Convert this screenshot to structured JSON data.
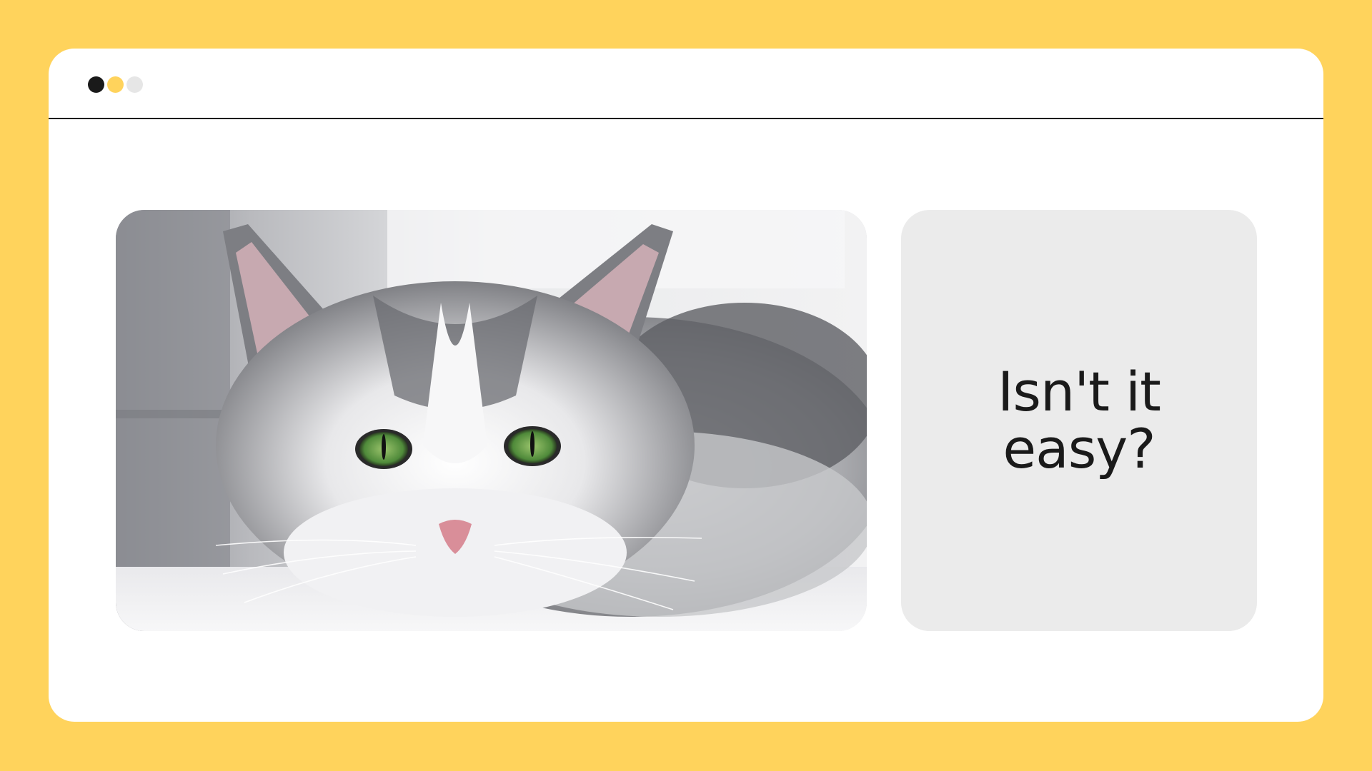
{
  "window": {
    "controls": [
      {
        "name": "close",
        "color": "#1A1A1A"
      },
      {
        "name": "minimize",
        "color": "#FFD35C"
      },
      {
        "name": "maximize",
        "color": "#E6E6E6"
      }
    ]
  },
  "background_color": "#FFD35C",
  "content": {
    "photo": {
      "subject": "cat-photo"
    },
    "caption": "Isn't it easy?"
  }
}
